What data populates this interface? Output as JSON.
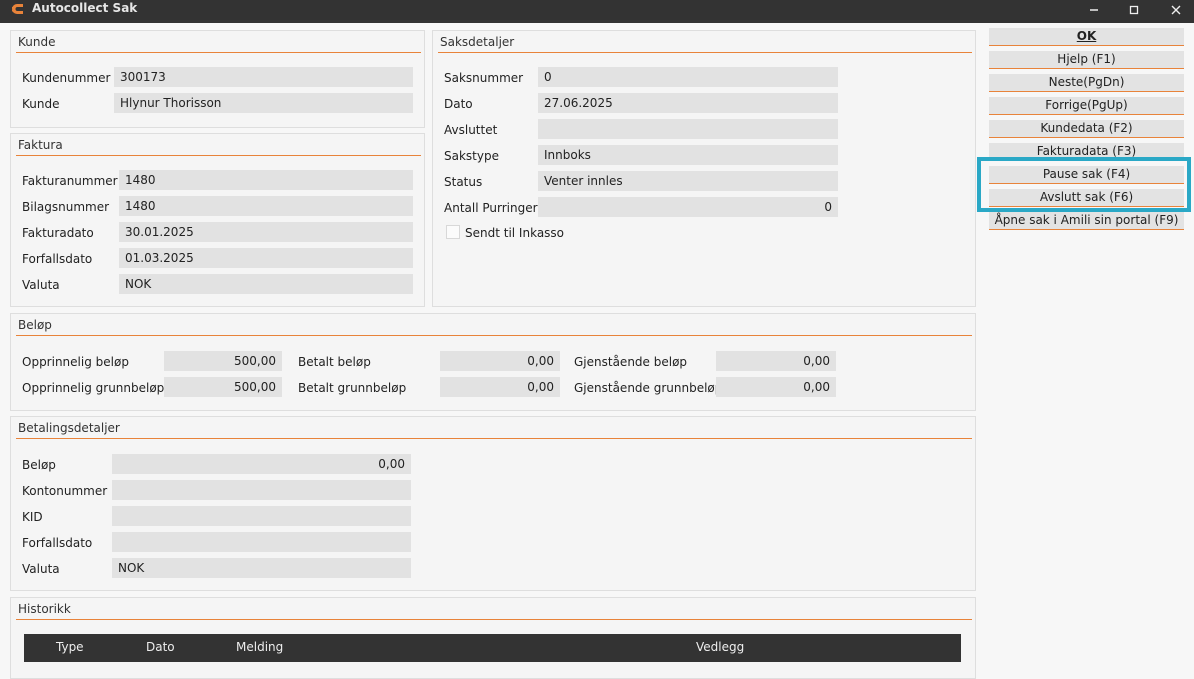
{
  "window": {
    "title": "Autocollect Sak",
    "minimize": "—",
    "maximize": "☐",
    "close": "✕"
  },
  "kunde": {
    "heading": "Kunde",
    "kundenummer_label": "Kundenummer",
    "kundenummer": "300173",
    "kunde_label": "Kunde",
    "kunde": "Hlynur Thorisson"
  },
  "faktura": {
    "heading": "Faktura",
    "fakturanummer_label": "Fakturanummer",
    "fakturanummer": "1480",
    "bilagsnummer_label": "Bilagsnummer",
    "bilagsnummer": "1480",
    "fakturadato_label": "Fakturadato",
    "fakturadato": "30.01.2025",
    "forfallsdato_label": "Forfallsdato",
    "forfallsdato": "01.03.2025",
    "valuta_label": "Valuta",
    "valuta": "NOK"
  },
  "saksdetaljer": {
    "heading": "Saksdetaljer",
    "saksnummer_label": "Saksnummer",
    "saksnummer": "0",
    "dato_label": "Dato",
    "dato": "27.06.2025",
    "avsluttet_label": "Avsluttet",
    "avsluttet": "",
    "sakstype_label": "Sakstype",
    "sakstype": "Innboks",
    "status_label": "Status",
    "status": "Venter innles",
    "antall_purringer_label": "Antall Purringer",
    "antall_purringer": "0",
    "sendt_inkasso_label": "Sendt til Inkasso"
  },
  "belop": {
    "heading": "Beløp",
    "opprinnelig_belop_label": "Opprinnelig beløp",
    "opprinnelig_belop": "500,00",
    "opprinnelig_grunnbelop_label": "Opprinnelig grunnbeløp",
    "opprinnelig_grunnbelop": "500,00",
    "betalt_belop_label": "Betalt beløp",
    "betalt_belop": "0,00",
    "betalt_grunnbelop_label": "Betalt grunnbeløp",
    "betalt_grunnbelop": "0,00",
    "gjenstaende_belop_label": "Gjenstående beløp",
    "gjenstaende_belop": "0,00",
    "gjenstaende_grunnbelop_label": "Gjenstående grunnbeløp",
    "gjenstaende_grunnbelop": "0,00"
  },
  "betalingsdetaljer": {
    "heading": "Betalingsdetaljer",
    "belop_label": "Beløp",
    "belop": "0,00",
    "kontonummer_label": "Kontonummer",
    "kontonummer": "",
    "kid_label": "KID",
    "kid": "",
    "forfallsdato_label": "Forfallsdato",
    "forfallsdato": "",
    "valuta_label": "Valuta",
    "valuta": "NOK"
  },
  "historikk": {
    "heading": "Historikk",
    "columns": [
      "Type",
      "Dato",
      "Melding",
      "Vedlegg"
    ]
  },
  "buttons": {
    "ok": "OK",
    "hjelp": "Hjelp (F1)",
    "neste": "Neste(PgDn)",
    "forrige": "Forrige(PgUp)",
    "kundedata": "Kundedata (F2)",
    "fakturadata": "Fakturadata (F3)",
    "pause": "Pause sak (F4)",
    "avslutt": "Avslutt sak (F6)",
    "apne": "Åpne sak i Amili sin portal (F9)"
  },
  "colors": {
    "accent": "#e8833a",
    "highlight": "#2aa8c6",
    "titlebar": "#333333",
    "field": "#e2e2e2"
  }
}
